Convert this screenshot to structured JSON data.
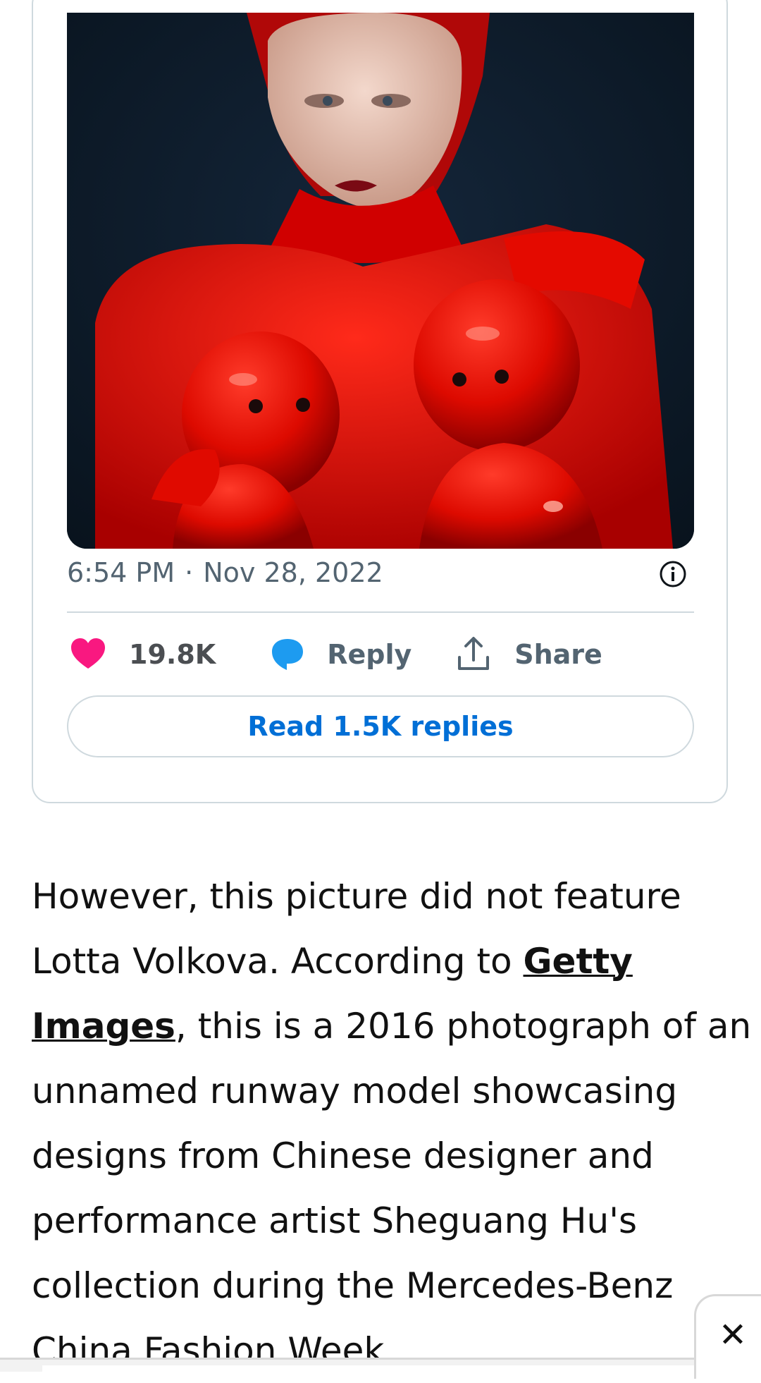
{
  "tweet": {
    "media": {
      "icon": "photo-red-outfit-model-with-dolls"
    },
    "time": "6:54 PM",
    "separator": "·",
    "date": "Nov 28, 2022",
    "info_icon": "info-icon",
    "actions": {
      "like": {
        "icon": "heart-icon",
        "label": "19.8K",
        "color": "#f91880"
      },
      "reply": {
        "icon": "speech-bubble-icon",
        "label": "Reply",
        "color": "#1d9bf0"
      },
      "share": {
        "icon": "share-upload-icon",
        "label": "Share"
      }
    },
    "read_replies_label": "Read 1.5K replies"
  },
  "article": {
    "lines": [
      {
        "text": "However, this picture did not feature"
      },
      {
        "before": "Lotta Volkova. According to ",
        "link": "Getty"
      },
      {
        "link": "Images",
        "after": ", this is a 2016 photograph of an"
      },
      {
        "text": "unnamed runway model showcasing"
      },
      {
        "text": "designs from Chinese designer and"
      },
      {
        "text": "performance artist Sheguang Hu's"
      },
      {
        "text": "collection during the Mercedes-Benz"
      },
      {
        "text": "China Fashion Week"
      }
    ]
  },
  "ad": {
    "close_label": "✕"
  },
  "colors": {
    "link_blue": "#006fd6",
    "meta_gray": "#536471",
    "border": "#cfd9de"
  }
}
